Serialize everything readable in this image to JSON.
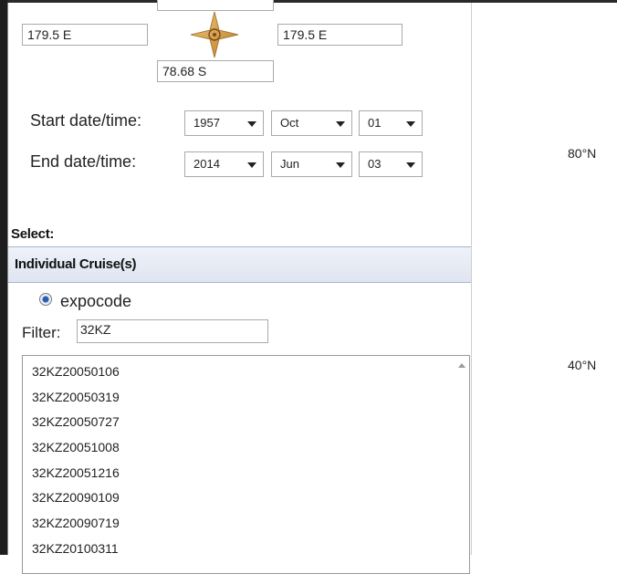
{
  "bounds": {
    "north": "",
    "west": "179.5 E",
    "east": "179.5 E",
    "south": "78.68 S"
  },
  "dates": {
    "start_label": "Start date/time:",
    "end_label": "End date/time:",
    "start": {
      "year": "1957",
      "month": "Oct",
      "day": "01"
    },
    "end": {
      "year": "2014",
      "month": "Jun",
      "day": "03"
    }
  },
  "map": {
    "lat_labels": [
      "80°N",
      "40°N"
    ]
  },
  "select": {
    "label": "Select:",
    "section_header": "Individual Cruise(s)",
    "radio_label": "expocode",
    "radio_selected": true,
    "filter_label": "Filter:",
    "filter_value": "32KZ"
  },
  "cruise_list": [
    "32KZ20050106",
    "32KZ20050319",
    "32KZ20050727",
    "32KZ20051008",
    "32KZ20051216",
    "32KZ20090109",
    "32KZ20090719",
    "32KZ20100311"
  ],
  "colors": {
    "compass": "#d8a04a",
    "header_bg": "#e6ebf5",
    "radio_dot": "#2a5db0"
  }
}
